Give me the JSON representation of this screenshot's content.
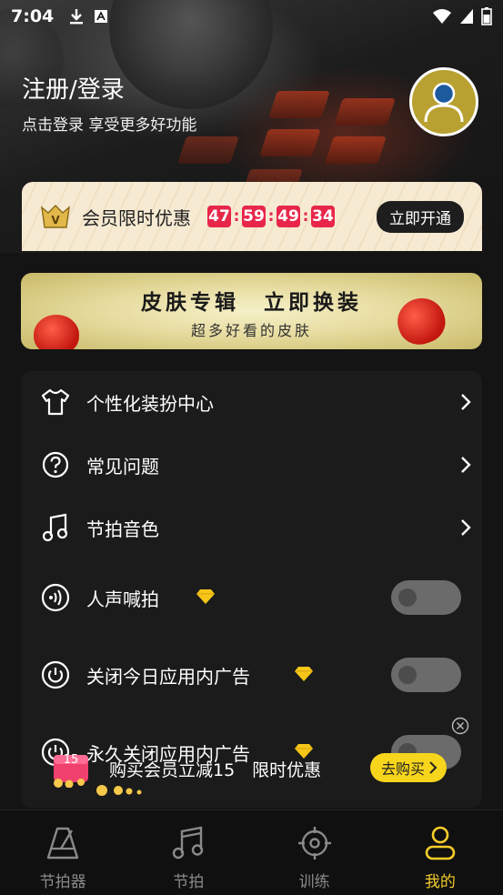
{
  "status_bar": {
    "time": "7:04"
  },
  "profile": {
    "login_title": "注册/登录",
    "login_subtitle": "点击登录 享受更多好功能"
  },
  "vip": {
    "badge": "V",
    "label": "会员限时优惠",
    "countdown": [
      "47",
      "59",
      "49",
      "34"
    ],
    "separator": ":",
    "button": "立即开通"
  },
  "skin_banner": {
    "title": "皮肤专辑　立即换装",
    "subtitle": "超多好看的皮肤"
  },
  "menu": {
    "items": [
      {
        "label": "个性化装扮中心",
        "icon": "shirt-icon",
        "control": "chevron"
      },
      {
        "label": "常见问题",
        "icon": "question-icon",
        "control": "chevron"
      },
      {
        "label": "节拍音色",
        "icon": "music-note-icon",
        "control": "chevron"
      },
      {
        "label": "人声喊拍",
        "icon": "voice-icon",
        "control": "toggle",
        "premium": true,
        "on": false
      },
      {
        "label": "关闭今日应用内广告",
        "icon": "power-icon",
        "control": "toggle",
        "premium": true,
        "on": false
      },
      {
        "label": "永久关闭应用内广告",
        "icon": "power-icon",
        "control": "toggle",
        "premium": true,
        "on": false
      }
    ]
  },
  "promo": {
    "gift_number": "15",
    "text": "购买会员立减15　限时优惠",
    "button": "去购买"
  },
  "tabs": [
    {
      "label": "节拍器",
      "icon": "metronome-icon",
      "active": false
    },
    {
      "label": "节拍",
      "icon": "music-note-icon",
      "active": false
    },
    {
      "label": "训练",
      "icon": "target-icon",
      "active": false
    },
    {
      "label": "我的",
      "icon": "user-icon",
      "active": true
    }
  ],
  "colors": {
    "accent": "#f5cc2a",
    "countdown": "#e8264a",
    "avatar_bg": "#b8a131",
    "promo_button": "#f7d51c"
  }
}
